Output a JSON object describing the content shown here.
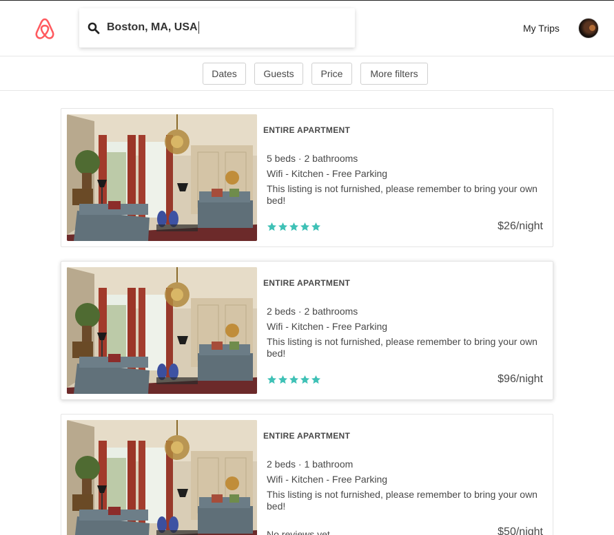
{
  "header": {
    "search": {
      "value": "Boston, MA, USA",
      "placeholder": ""
    },
    "my_trips_label": "My Trips"
  },
  "filters": [
    {
      "label": "Dates"
    },
    {
      "label": "Guests"
    },
    {
      "label": "Price"
    },
    {
      "label": "More filters"
    }
  ],
  "listings": [
    {
      "type": "ENTIRE APARTMENT",
      "specs": "5 beds · 2 bathrooms",
      "amenities": "Wifi - Kitchen - Free Parking",
      "description": "This listing is not furnished, please remember to bring your own bed!",
      "rating_stars": 5,
      "price": "$26/night"
    },
    {
      "type": "ENTIRE APARTMENT",
      "specs": "2 beds · 2 bathrooms",
      "amenities": "Wifi - Kitchen - Free Parking",
      "description": "This listing is not furnished, please remember to bring your own bed!",
      "rating_stars": 5,
      "price": "$96/night"
    },
    {
      "type": "ENTIRE APARTMENT",
      "specs": "2 beds · 1 bathroom",
      "amenities": "Wifi - Kitchen - Free Parking",
      "description": "This listing is not furnished, please remember to bring your own bed!",
      "reviews_text": "No reviews yet",
      "price": "$50/night"
    }
  ],
  "colors": {
    "brand": "#ff5a5f",
    "star": "#3fc1b6",
    "text": "#484848"
  },
  "icons": {
    "logo": "airbnb-logo",
    "search": "search-icon",
    "star": "star-icon"
  }
}
